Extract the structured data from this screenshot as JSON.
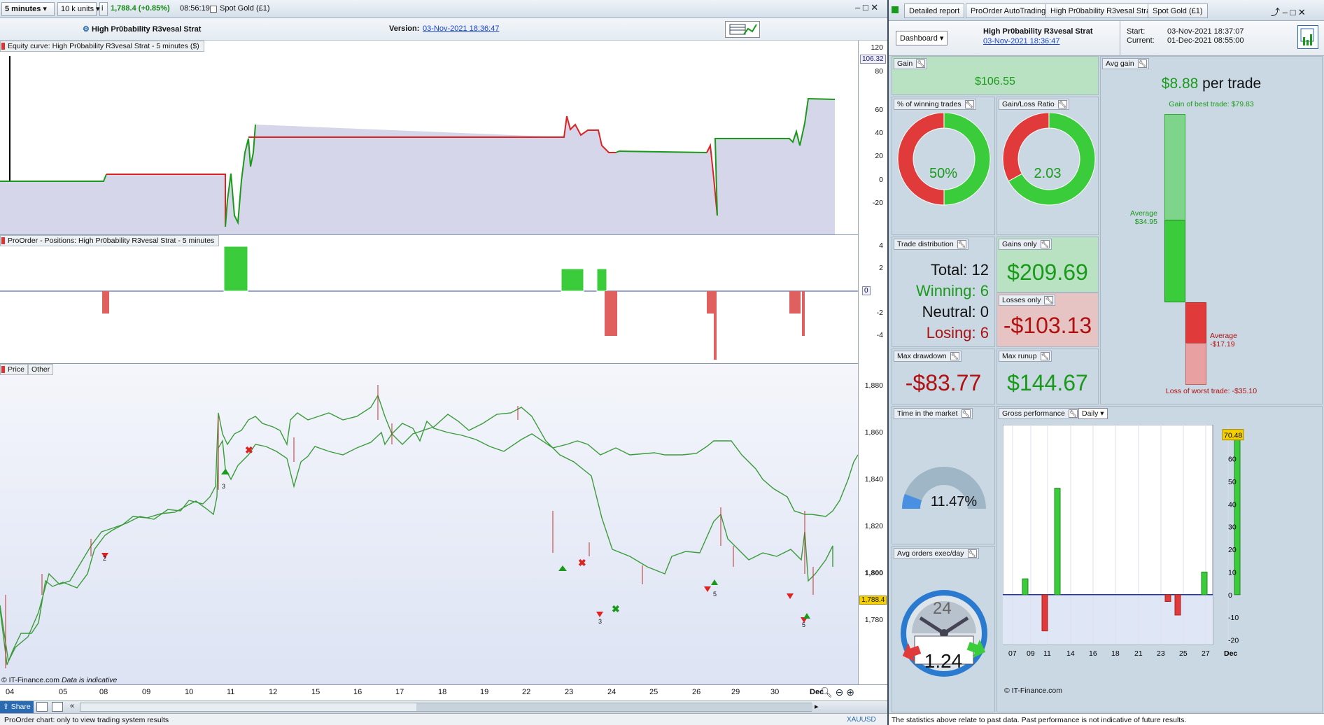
{
  "toolbar": {
    "timeframe": "5 minutes",
    "units": "10 k units",
    "price": "1,788.4 (+0.85%)",
    "time": "08:56:19",
    "instrument": "Spot Gold (£1)"
  },
  "header": {
    "strategy": "High Pr0bability R3vesal Strat",
    "version_label": "Version:",
    "version_date": "03-Nov-2021 18:36:47"
  },
  "equity": {
    "title": "Equity curve: High Pr0bability R3vesal Strat - 5 minutes ($)",
    "ticks": [
      "120",
      "100",
      "80",
      "60",
      "40",
      "20",
      "0",
      "-20"
    ],
    "last": "106.32"
  },
  "positions": {
    "title": "ProOrder - Positions: High Pr0bability R3vesal Strat - 5 minutes",
    "ticks": [
      "4",
      "2",
      "0",
      "-2",
      "-4"
    ],
    "last": "0"
  },
  "price": {
    "tab_price": "Price",
    "tab_other": "Other",
    "ticks": [
      "1,880",
      "1,860",
      "1,840",
      "1,820",
      "1,800",
      "1,780"
    ],
    "last": "1,788.4",
    "watermark": "© IT-Finance.com",
    "note": "Data is indicative",
    "labels": [
      "3",
      "2",
      "3",
      "5",
      "5"
    ]
  },
  "xaxis": [
    "04",
    "05",
    "08",
    "09",
    "10",
    "11",
    "12",
    "15",
    "16",
    "17",
    "18",
    "19",
    "22",
    "23",
    "24",
    "25",
    "26",
    "29",
    "30",
    "Dec"
  ],
  "bottombar": {
    "share": "Share",
    "symbol": "XAUUSD"
  },
  "status_left": "ProOrder chart: only to view trading system results",
  "right": {
    "tabs": [
      "Detailed report",
      "ProOrder AutoTrading",
      "High Pr0bability R3vesal Strat",
      "Spot Gold (£1)"
    ],
    "dashboard": "Dashboard",
    "strategy": "High Pr0bability R3vesal Strat",
    "strategy_date": "03-Nov-2021 18:36:47",
    "start_label": "Start:",
    "start": "03-Nov-2021 18:37:07",
    "current_label": "Current:",
    "current": "01-Dec-2021 08:55:00",
    "gain_label": "Gain",
    "gain": "$106.55",
    "avg_gain_label": "Avg gain",
    "avg_gain": "$8.88",
    "avg_gain_suffix": "per trade",
    "best_trade": "Gain of best trade: $79.83",
    "avg_win_label": "Average",
    "avg_win": "$34.95",
    "avg_loss_label": "Average",
    "avg_loss": "-$17.19",
    "worst_trade": "Loss of worst trade: -$35.10",
    "winning_pct_label": "% of winning trades",
    "winning_pct": "50%",
    "winning_frac": 0.5,
    "gl_ratio_label": "Gain/Loss Ratio",
    "gl_ratio": "2.03",
    "gl_frac": 0.67,
    "trade_dist_label": "Trade distribution",
    "total": "Total: 12",
    "winning": "Winning: 6",
    "neutral": "Neutral: 0",
    "losing": "Losing: 6",
    "gains_only_label": "Gains only",
    "gains_only": "$209.69",
    "losses_only_label": "Losses only",
    "losses_only": "-$103.13",
    "max_dd_label": "Max drawdown",
    "max_dd": "-$83.77",
    "max_runup_label": "Max runup",
    "max_runup": "$144.67",
    "time_market_label": "Time in the market",
    "time_market": "11.47%",
    "time_market_frac": 0.1147,
    "avg_orders_label": "Avg orders exec/day",
    "avg_orders": "1.24",
    "avg_orders_max": "24",
    "gross_label": "Gross performance",
    "gross_period": "Daily",
    "gross_last": "70.48",
    "gross_watermark": "© IT-Finance.com",
    "footer": "The statistics above relate to past data. Past performance is not indicative of future results."
  },
  "chart_data": {
    "type": "bar",
    "title": "Gross performance",
    "categories": [
      "08",
      "10",
      "11",
      "23",
      "24",
      "26",
      "30"
    ],
    "values": [
      7,
      -16,
      47,
      -3,
      -9,
      10,
      70.48
    ],
    "x_ticks": [
      "07",
      "09",
      "11",
      "14",
      "16",
      "18",
      "21",
      "23",
      "25",
      "27",
      "Dec"
    ],
    "y_ticks": [
      "60",
      "50",
      "40",
      "30",
      "20",
      "10",
      "0",
      "-10",
      "-20"
    ],
    "ylim": [
      -22,
      75
    ]
  }
}
